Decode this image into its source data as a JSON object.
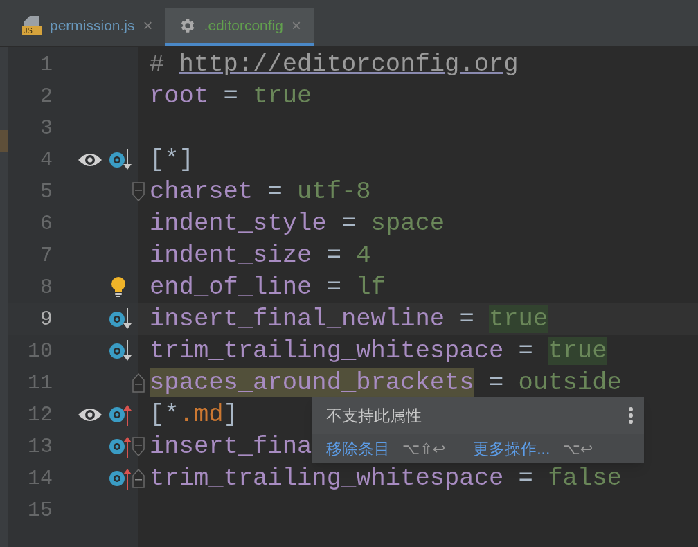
{
  "tabs": [
    {
      "kind": "js",
      "badge": "JS",
      "label": "permission.js",
      "close": "×",
      "selected": false
    },
    {
      "kind": "gear",
      "label": ".editorconfig",
      "close": "×",
      "selected": true
    }
  ],
  "lines": [
    {
      "number": "1",
      "current": false,
      "eye": false,
      "bulb": false,
      "tokens": [
        {
          "text": "# ",
          "kind": "comment"
        },
        {
          "text": "http://editorconfig.org",
          "kind": "link"
        }
      ]
    },
    {
      "number": "2",
      "current": false,
      "eye": false,
      "bulb": false,
      "tokens": [
        {
          "text": "root",
          "kind": "key"
        },
        {
          "text": " = ",
          "kind": "op"
        },
        {
          "text": "true",
          "kind": "value"
        }
      ]
    },
    {
      "number": "3",
      "current": false,
      "eye": false,
      "bulb": false
    },
    {
      "number": "4",
      "current": false,
      "eye": true,
      "marker": {
        "kind": "down"
      },
      "bulb": false,
      "tokens": [
        {
          "text": "[*]",
          "kind": "op"
        }
      ]
    },
    {
      "number": "5",
      "current": false,
      "eye": false,
      "fold": {
        "kind": "start"
      },
      "bulb": false,
      "tokens": [
        {
          "text": "charset",
          "kind": "key"
        },
        {
          "text": " = ",
          "kind": "op"
        },
        {
          "text": "utf-8",
          "kind": "value"
        }
      ]
    },
    {
      "number": "6",
      "current": false,
      "eye": false,
      "bulb": false,
      "tokens": [
        {
          "text": "indent_style",
          "kind": "key"
        },
        {
          "text": " = ",
          "kind": "op"
        },
        {
          "text": "space",
          "kind": "value"
        }
      ]
    },
    {
      "number": "7",
      "current": false,
      "eye": false,
      "bulb": false,
      "tokens": [
        {
          "text": "indent_size",
          "kind": "key"
        },
        {
          "text": " = ",
          "kind": "op"
        },
        {
          "text": "4",
          "kind": "value"
        }
      ]
    },
    {
      "number": "8",
      "current": false,
      "eye": false,
      "bulb": true,
      "tokens": [
        {
          "text": "end_of_line",
          "kind": "key"
        },
        {
          "text": " = ",
          "kind": "op"
        },
        {
          "text": "lf",
          "kind": "value"
        }
      ]
    },
    {
      "number": "9",
      "current": true,
      "eye": false,
      "marker": {
        "kind": "down"
      },
      "bulb": false,
      "tokens": [
        {
          "text": "insert_final_newline",
          "kind": "key"
        },
        {
          "text": " = ",
          "kind": "op"
        },
        {
          "text": "true",
          "kind": "value",
          "highlight": {
            "kind": "match"
          }
        }
      ]
    },
    {
      "number": "10",
      "current": false,
      "eye": false,
      "marker": {
        "kind": "down"
      },
      "bulb": false,
      "tokens": [
        {
          "text": "trim_trailing_whitespace",
          "kind": "key"
        },
        {
          "text": " = ",
          "kind": "op"
        },
        {
          "text": "true",
          "kind": "value",
          "highlight": {
            "kind": "match"
          }
        }
      ]
    },
    {
      "number": "11",
      "current": false,
      "eye": false,
      "fold": {
        "kind": "end"
      },
      "bulb": false,
      "tokens": [
        {
          "text": "spaces_around_brackets",
          "kind": "key",
          "highlight": {
            "kind": "warning"
          }
        },
        {
          "text": " = ",
          "kind": "op"
        },
        {
          "text": "outside",
          "kind": "value"
        }
      ]
    },
    {
      "number": "12",
      "current": false,
      "eye": true,
      "marker": {
        "kind": "up"
      },
      "bulb": false,
      "tokens": [
        {
          "text": "[*",
          "kind": "op"
        },
        {
          "text": ".md",
          "kind": "ext"
        },
        {
          "text": "]",
          "kind": "op"
        }
      ]
    },
    {
      "number": "13",
      "current": false,
      "eye": false,
      "marker": {
        "kind": "up"
      },
      "fold": {
        "kind": "start"
      },
      "bulb": false,
      "tokens": [
        {
          "text": "insert_fina",
          "kind": "key"
        }
      ]
    },
    {
      "number": "14",
      "current": false,
      "eye": false,
      "marker": {
        "kind": "up"
      },
      "fold": {
        "kind": "end"
      },
      "bulb": false,
      "tokens": [
        {
          "text": "trim_trailing_whitespace",
          "kind": "key"
        },
        {
          "text": " = ",
          "kind": "op"
        },
        {
          "text": "false",
          "kind": "value"
        }
      ]
    },
    {
      "number": "15",
      "current": false,
      "eye": false,
      "bulb": false
    }
  ],
  "popup": {
    "message": "不支持此属性",
    "actions": [
      {
        "label": "移除条目",
        "shortcut": "⌥⇧↩"
      },
      {
        "label": "更多操作...",
        "shortcut": "⌥↩"
      }
    ]
  }
}
